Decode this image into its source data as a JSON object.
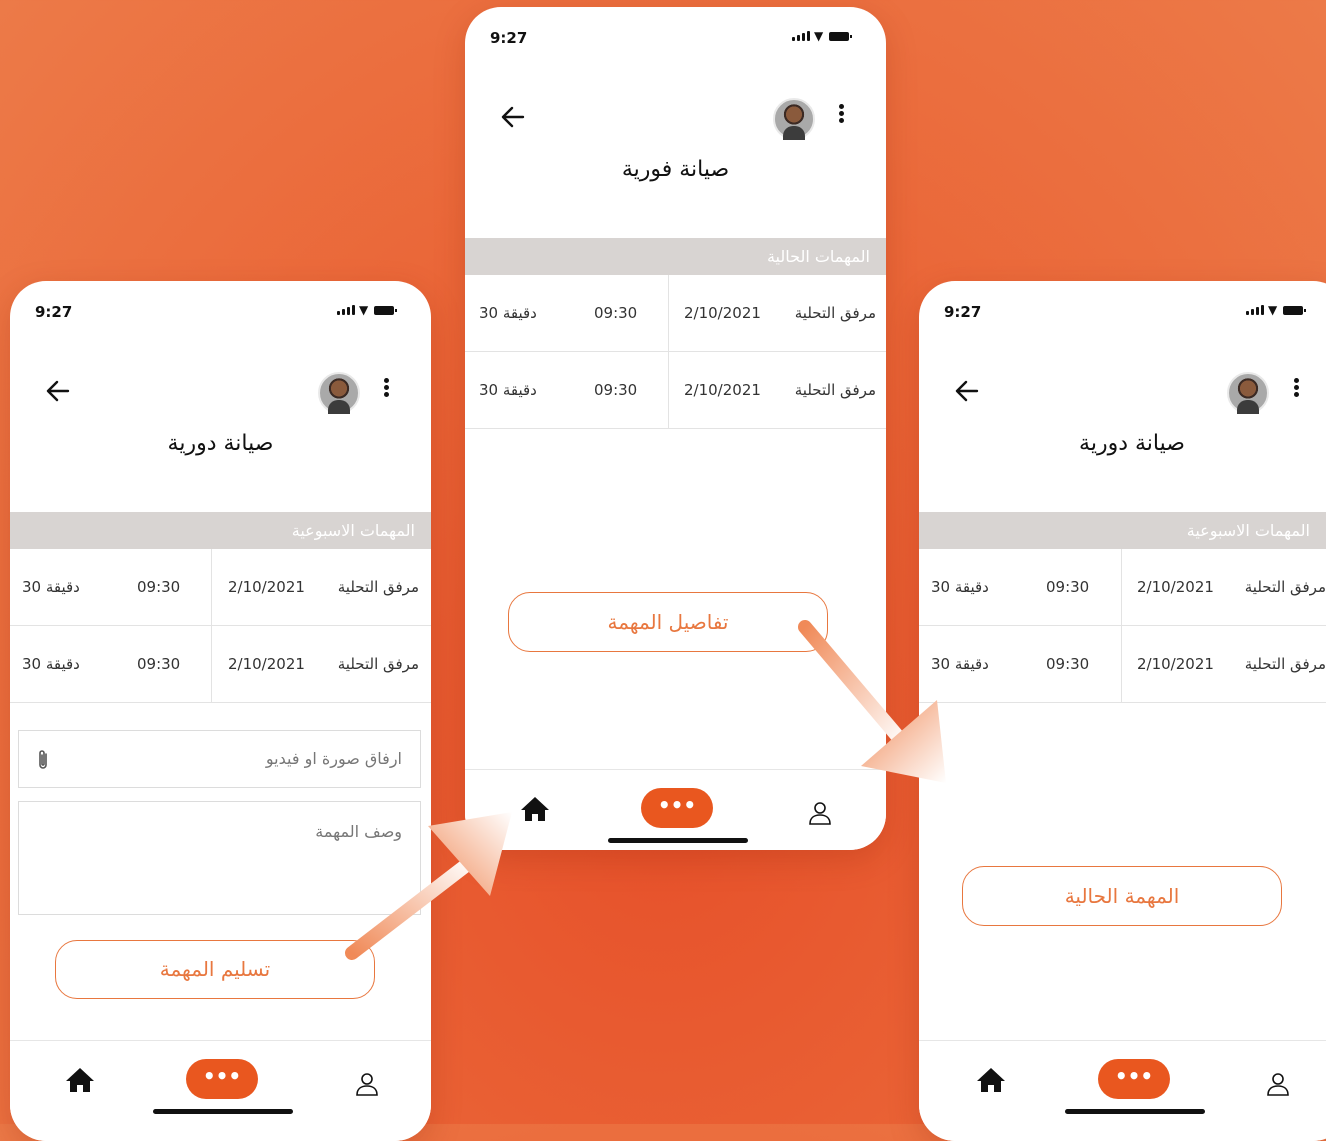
{
  "colors": {
    "accent": "#e8773f",
    "nav_button": "#e9571f",
    "section_bar": "#d8d4d2",
    "background": "#ea6436"
  },
  "icons": {
    "back": "back-arrow-icon",
    "menu": "kebab-menu-icon",
    "home": "home-icon",
    "more": "more-dots-icon",
    "profile": "user-icon",
    "attach": "paperclip-icon"
  },
  "left_screen": {
    "status_time": "9:27",
    "title": "صيانة دورية",
    "section_label": "المهمات الاسبوعية",
    "rows": [
      {
        "attachment": "مرفق التحلية",
        "date": "2/10/2021",
        "time": "09:30",
        "duration": "30 دقيقة"
      },
      {
        "attachment": "مرفق التحلية",
        "date": "2/10/2021",
        "time": "09:30",
        "duration": "30 دقيقة"
      }
    ],
    "attach_placeholder": "ارفاق صورة او فيديو",
    "description_placeholder": "وصف المهمة",
    "submit_button": "تسليم المهمة",
    "nav_more": "•••"
  },
  "middle_screen": {
    "status_time": "9:27",
    "title": "صيانة فورية",
    "section_label": "المهمات الحالية",
    "rows": [
      {
        "attachment": "مرفق التحلية",
        "date": "2/10/2021",
        "time": "09:30",
        "duration": "30 دقيقة"
      },
      {
        "attachment": "مرفق التحلية",
        "date": "2/10/2021",
        "time": "09:30",
        "duration": "30 دقيقة"
      }
    ],
    "details_button": "تفاصيل المهمة",
    "nav_more": "•••"
  },
  "right_screen": {
    "status_time": "9:27",
    "title": "صيانة دورية",
    "section_label": "المهمات الاسبوعية",
    "rows": [
      {
        "attachment": "مرفق التحلية",
        "date": "2/10/2021",
        "time": "09:30",
        "duration": "30 دقيقة"
      },
      {
        "attachment": "مرفق التحلية",
        "date": "2/10/2021",
        "time": "09:30",
        "duration": "30 دقيقة"
      }
    ],
    "current_button": "المهمة الحالية",
    "nav_more": "•••"
  }
}
